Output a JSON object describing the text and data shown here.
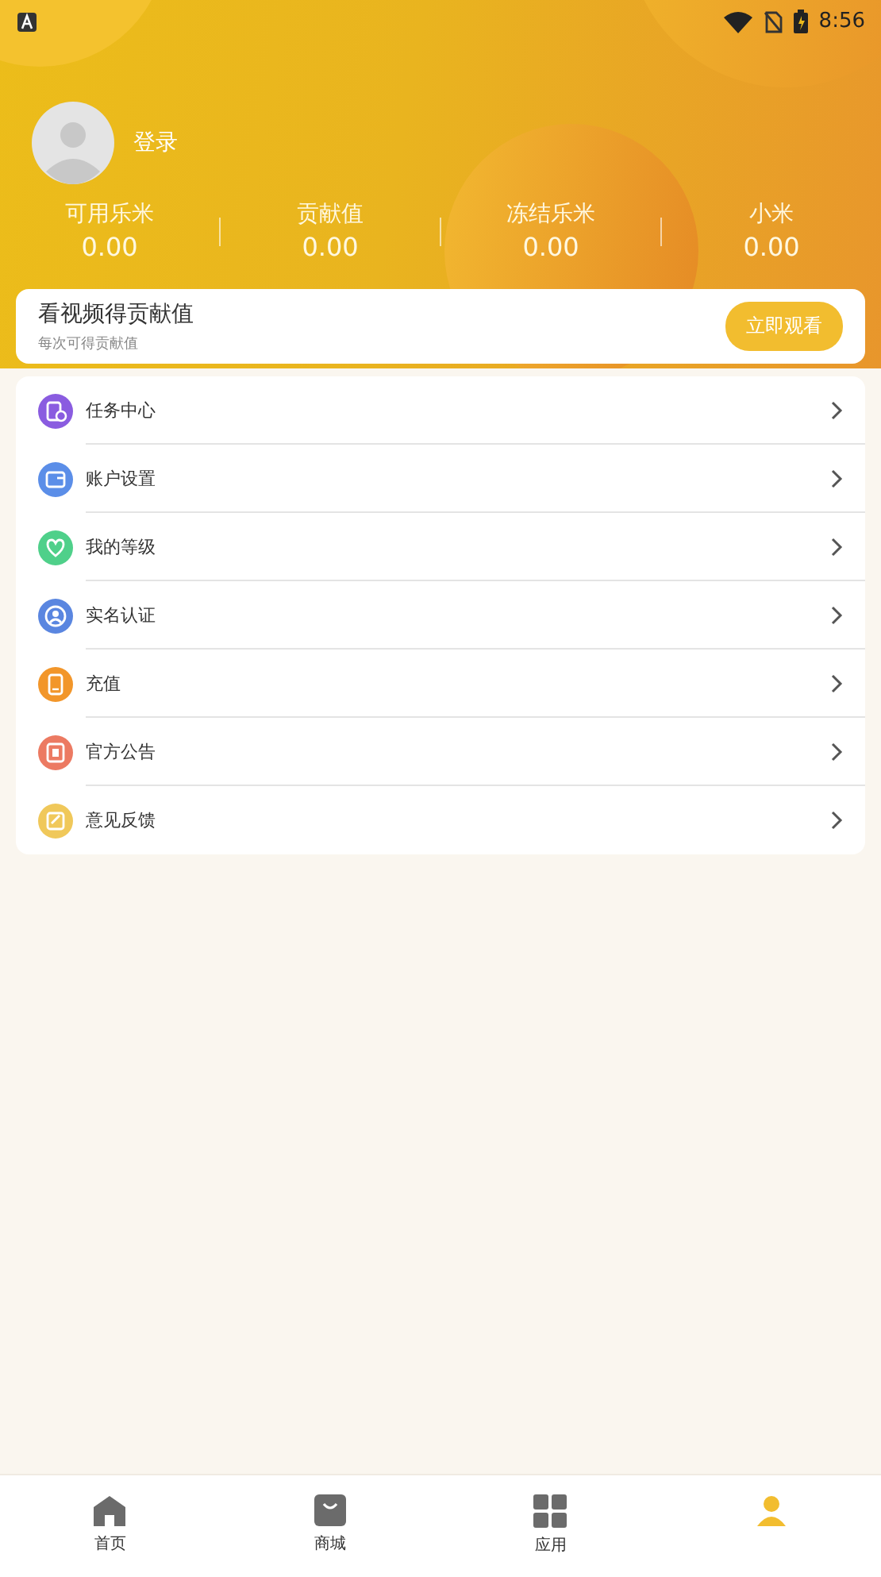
{
  "status_bar": {
    "time": "8:56"
  },
  "profile": {
    "login_label": "登录"
  },
  "stats": [
    {
      "label": "可用乐米",
      "value": "0.00"
    },
    {
      "label": "贡献值",
      "value": "0.00"
    },
    {
      "label": "冻结乐米",
      "value": "0.00"
    },
    {
      "label": "小米",
      "value": "0.00"
    }
  ],
  "video_card": {
    "title": "看视频得贡献值",
    "subtitle": "每次可得贡献值",
    "button": "立即观看"
  },
  "menu": [
    {
      "label": "任务中心",
      "color": "#8a5ce0"
    },
    {
      "label": "账户设置",
      "color": "#5b8ee8"
    },
    {
      "label": "我的等级",
      "color": "#4fd08a"
    },
    {
      "label": "实名认证",
      "color": "#5a86e0"
    },
    {
      "label": "充值",
      "color": "#f2962a"
    },
    {
      "label": "官方公告",
      "color": "#ec7a62"
    },
    {
      "label": "意见反馈",
      "color": "#f0c85a"
    }
  ],
  "tab_bar": [
    {
      "kind": "home",
      "label": "首页",
      "selected": false
    },
    {
      "kind": "shop",
      "label": "商城",
      "selected": false
    },
    {
      "kind": "apps",
      "label": "应用",
      "selected": false
    },
    {
      "kind": "person",
      "selected": true
    }
  ]
}
